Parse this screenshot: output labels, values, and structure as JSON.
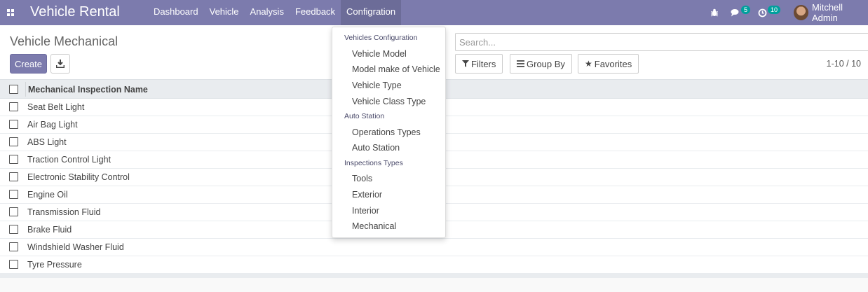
{
  "navbar": {
    "brand": "Vehicle Rental",
    "menu": [
      {
        "label": "Dashboard"
      },
      {
        "label": "Vehicle"
      },
      {
        "label": "Analysis"
      },
      {
        "label": "Feedback"
      },
      {
        "label": "Configration"
      }
    ],
    "active_menu": "Configration",
    "messages_count": "5",
    "activities_count": "10",
    "user_name": "Mitchell Admin",
    "color": "#7c7bad"
  },
  "control": {
    "breadcrumb": "Vehicle Mechanical",
    "create_label": "Create",
    "search_placeholder": "Search...",
    "filters_label": "Filters",
    "groupby_label": "Group By",
    "favorites_label": "Favorites",
    "pager": "1-10 / 10"
  },
  "list": {
    "column": "Mechanical Inspection Name",
    "rows": [
      "Seat Belt Light",
      "Air Bag Light",
      "ABS Light",
      "Traction Control Light",
      "Electronic Stability Control",
      "Engine Oil",
      "Transmission Fluid",
      "Brake Fluid",
      "Windshield Washer Fluid",
      "Tyre Pressure"
    ]
  },
  "dropdown": {
    "sections": [
      {
        "header": "Vehicles Configuration",
        "items": [
          "Vehicle Model",
          "Model make of Vehicle",
          "Vehicle Type",
          "Vehicle Class Type"
        ]
      },
      {
        "header": "Auto Station",
        "items": [
          "Operations Types",
          "Auto Station"
        ]
      },
      {
        "header": "Inspections Types",
        "items": [
          "Tools",
          "Exterior",
          "Interior",
          "Mechanical"
        ]
      }
    ]
  }
}
